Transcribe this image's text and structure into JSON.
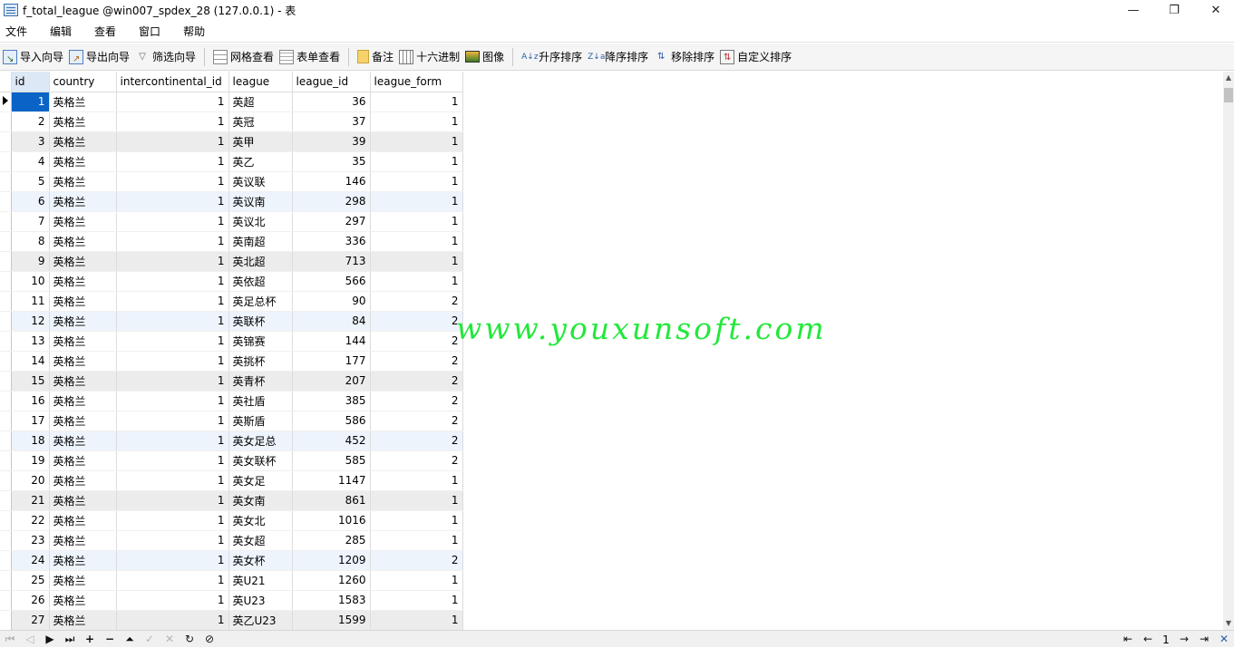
{
  "window": {
    "title": "f_total_league @win007_spdex_28 (127.0.0.1) - 表",
    "minimize": "—",
    "restore": "❐",
    "close": "✕"
  },
  "menu": [
    "文件",
    "编辑",
    "查看",
    "窗口",
    "帮助"
  ],
  "toolbar": {
    "import_wizard": "导入向导",
    "export_wizard": "导出向导",
    "filter_wizard": "筛选向导",
    "grid_view": "网格查看",
    "form_view": "表单查看",
    "memo": "备注",
    "hex": "十六进制",
    "image": "图像",
    "sort_asc": "升序排序",
    "sort_desc": "降序排序",
    "remove_sort": "移除排序",
    "custom_sort": "自定义排序"
  },
  "grid": {
    "columns": [
      "id",
      "country",
      "intercontinental_id",
      "league",
      "league_id",
      "league_form"
    ],
    "rows": [
      [
        "1",
        "英格兰",
        "1",
        "英超",
        "36",
        "1"
      ],
      [
        "2",
        "英格兰",
        "1",
        "英冠",
        "37",
        "1"
      ],
      [
        "3",
        "英格兰",
        "1",
        "英甲",
        "39",
        "1"
      ],
      [
        "4",
        "英格兰",
        "1",
        "英乙",
        "35",
        "1"
      ],
      [
        "5",
        "英格兰",
        "1",
        "英议联",
        "146",
        "1"
      ],
      [
        "6",
        "英格兰",
        "1",
        "英议南",
        "298",
        "1"
      ],
      [
        "7",
        "英格兰",
        "1",
        "英议北",
        "297",
        "1"
      ],
      [
        "8",
        "英格兰",
        "1",
        "英南超",
        "336",
        "1"
      ],
      [
        "9",
        "英格兰",
        "1",
        "英北超",
        "713",
        "1"
      ],
      [
        "10",
        "英格兰",
        "1",
        "英依超",
        "566",
        "1"
      ],
      [
        "11",
        "英格兰",
        "1",
        "英足总杯",
        "90",
        "2"
      ],
      [
        "12",
        "英格兰",
        "1",
        "英联杯",
        "84",
        "2"
      ],
      [
        "13",
        "英格兰",
        "1",
        "英锦赛",
        "144",
        "2"
      ],
      [
        "14",
        "英格兰",
        "1",
        "英挑杯",
        "177",
        "2"
      ],
      [
        "15",
        "英格兰",
        "1",
        "英青杯",
        "207",
        "2"
      ],
      [
        "16",
        "英格兰",
        "1",
        "英社盾",
        "385",
        "2"
      ],
      [
        "17",
        "英格兰",
        "1",
        "英斯盾",
        "586",
        "2"
      ],
      [
        "18",
        "英格兰",
        "1",
        "英女足总",
        "452",
        "2"
      ],
      [
        "19",
        "英格兰",
        "1",
        "英女联杯",
        "585",
        "2"
      ],
      [
        "20",
        "英格兰",
        "1",
        "英女足",
        "1147",
        "1"
      ],
      [
        "21",
        "英格兰",
        "1",
        "英女南",
        "861",
        "1"
      ],
      [
        "22",
        "英格兰",
        "1",
        "英女北",
        "1016",
        "1"
      ],
      [
        "23",
        "英格兰",
        "1",
        "英女超",
        "285",
        "1"
      ],
      [
        "24",
        "英格兰",
        "1",
        "英女杯",
        "1209",
        "2"
      ],
      [
        "25",
        "英格兰",
        "1",
        "英U21",
        "1260",
        "1"
      ],
      [
        "26",
        "英格兰",
        "1",
        "英U23",
        "1583",
        "1"
      ],
      [
        "27",
        "英格兰",
        "1",
        "英乙U23",
        "1599",
        "1"
      ]
    ]
  },
  "watermark": "www.youxunsoft.com",
  "pager": {
    "page": "1"
  },
  "colors": {
    "selection": "#0a64c8",
    "watermark": "#22e83a",
    "alt_row": "#ececec",
    "hover_row": "#edf4fc"
  }
}
